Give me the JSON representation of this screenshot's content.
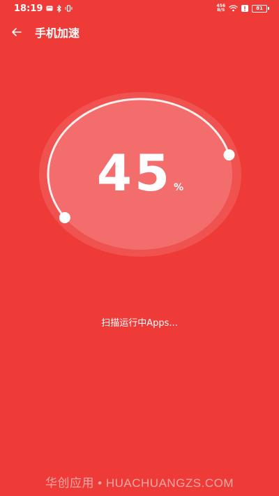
{
  "status_bar": {
    "time": "18:19",
    "net_speed_value": "456",
    "net_speed_unit": "B/S",
    "battery_level": "81"
  },
  "header": {
    "title": "手机加速"
  },
  "gauge": {
    "value": "45",
    "unit": "%",
    "progress_fraction": 0.45
  },
  "status": {
    "scan_text": "扫描运行中Apps..."
  },
  "watermark": {
    "text": "华创应用 • HUACHUANGZS.COM"
  },
  "colors": {
    "background": "#EE3B38",
    "accent": "#FFFFFF"
  }
}
